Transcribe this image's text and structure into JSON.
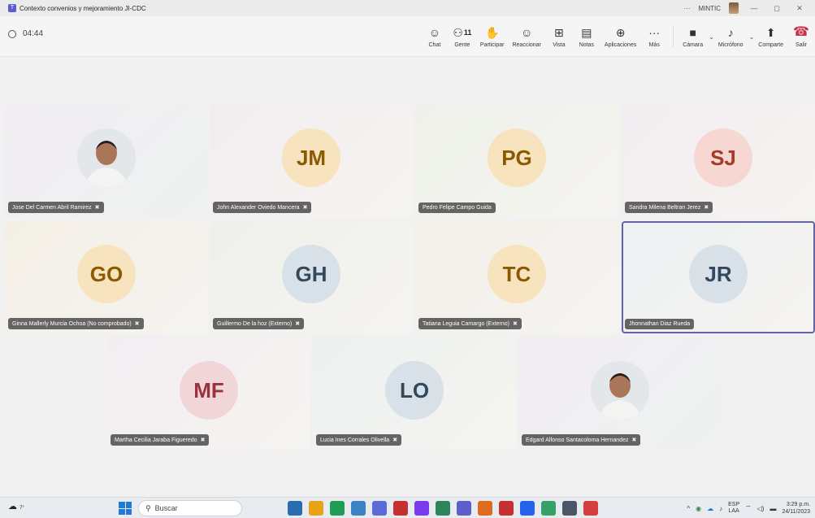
{
  "window": {
    "title": "Contexto convenios y mejoramiento JI-CDC",
    "more": "···",
    "org": "MINTIC",
    "minimize": "—",
    "restore": "◻",
    "close": "✕"
  },
  "meeting": {
    "elapsed": "04:44",
    "toolbar": [
      {
        "id": "chat",
        "icon": "☺",
        "label": "Chat"
      },
      {
        "id": "people",
        "icon": "⚇",
        "label": "Gente",
        "count": "11"
      },
      {
        "id": "raise",
        "icon": "✋",
        "label": "Participar"
      },
      {
        "id": "react",
        "icon": "☺",
        "label": "Reaccionar"
      },
      {
        "id": "view",
        "icon": "⊞",
        "label": "Vista"
      },
      {
        "id": "notes",
        "icon": "▤",
        "label": "Notas"
      },
      {
        "id": "apps",
        "icon": "⊕",
        "label": "Aplicaciones"
      },
      {
        "id": "more",
        "icon": "···",
        "label": "Más"
      }
    ],
    "controls": {
      "camera": {
        "icon": "■",
        "label": "Cámara"
      },
      "mic": {
        "icon": "♪",
        "label": "Micrófono"
      },
      "share": {
        "icon": "⬆",
        "label": "Comparte"
      },
      "leave": {
        "icon": "☎",
        "label": "Salir"
      }
    }
  },
  "participants": [
    {
      "name": "Jose Del Carmen Abril Ramirez",
      "initials": "",
      "photo": true,
      "muted": true
    },
    {
      "name": "John Alexander Oviedo Mancera",
      "initials": "JM",
      "muted": true,
      "circle": "#f7e3bd",
      "text": "#8a5a00",
      "bg": "#f2ecef"
    },
    {
      "name": "Pedro Felipe Campo Guida",
      "initials": "PG",
      "muted": false,
      "circle": "#f7e3bd",
      "text": "#8a5a00",
      "bg": "#eef1ea"
    },
    {
      "name": "Sandra Milena Beltran Jerez",
      "initials": "SJ",
      "muted": true,
      "circle": "#f6d7d2",
      "text": "#a33a2a",
      "bg": "#f2ecf0"
    },
    {
      "name": "Ginna Mallerly Murcia Ochoa (No comprobado)",
      "initials": "GO",
      "muted": true,
      "circle": "#f7e3bd",
      "text": "#8a5a00",
      "bg": "#f3efe6"
    },
    {
      "name": "Guillermo De la hoz (Externo)",
      "initials": "GH",
      "muted": true,
      "circle": "#d8e1e8",
      "text": "#32485c",
      "bg": "#eef0ea"
    },
    {
      "name": "Tatiana Leguia Camargo (Externo)",
      "initials": "TC",
      "muted": true,
      "circle": "#f7e3bd",
      "text": "#8a5a00",
      "bg": "#f3efea"
    },
    {
      "name": "Jhonnathan Diaz Rueda",
      "initials": "JR",
      "muted": false,
      "circle": "#d8e1e8",
      "text": "#32485c",
      "bg": "#edf0f2",
      "active": true
    },
    {
      "name": "Martha Cecilia Jaraba Figueredo",
      "initials": "MF",
      "muted": true,
      "circle": "#f1d6d8",
      "text": "#9a3040",
      "bg": "#f2edf1"
    },
    {
      "name": "Lucia Ines Corrales Olivella",
      "initials": "LO",
      "muted": true,
      "circle": "#d8e1e8",
      "text": "#32485c",
      "bg": "#ebf1ef"
    },
    {
      "name": "Edgard Alfonso Santacoloma Hernandez",
      "initials": "",
      "photo": true,
      "muted": true
    }
  ],
  "taskbar": {
    "weather": "7°",
    "search_placeholder": "Buscar",
    "apps": [
      "#2b6cb0",
      "#e8a317",
      "#1f9d55",
      "#3b82c4",
      "#5b6bd6",
      "#c53030",
      "#7c3aed",
      "#2f855a",
      "#5b5fc7",
      "#dd6b20",
      "#c53030",
      "#2563eb",
      "#38a169",
      "#4a5568",
      "#d53f3f"
    ],
    "lang_1": "ESP",
    "lang_2": "LAA",
    "time": "3:29 p.m.",
    "date": "24/11/2023",
    "tray_chevron": "^",
    "tray_wifi": "⌔",
    "tray_sound": "◁)",
    "tray_battery": "▬"
  }
}
